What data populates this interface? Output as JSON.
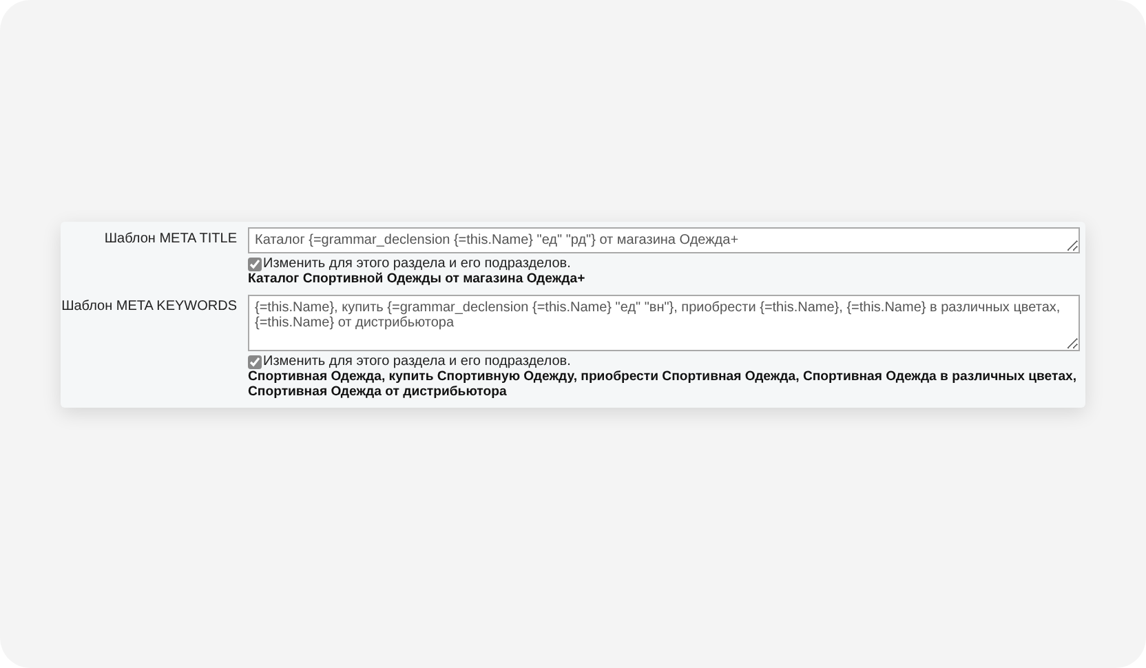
{
  "fields": [
    {
      "label": "Шаблон META TITLE",
      "value": "Каталог {=grammar_declension {=this.Name} \"ед\" \"рд\"} от магазина Одежда+",
      "kind": "line",
      "checkbox": {
        "label": "Изменить для этого раздела и его подразделов.",
        "checked": true
      },
      "preview": "Каталог Спортивной Одежды от магазина Одежда+"
    },
    {
      "label": "Шаблон META KEYWORDS",
      "value": "{=this.Name}, купить {=grammar_declension {=this.Name} \"ед\" \"вн\"}, приобрести {=this.Name}, {=this.Name} в различных цветах, {=this.Name} от дистрибьютора",
      "kind": "area",
      "checkbox": {
        "label": "Изменить для этого раздела и его подразделов.",
        "checked": true
      },
      "preview": "Спортивная Одежда, купить Спортивную Одежду, приобрести Спортивная Одежда, Спортивная Одежда в различных цветах, Спортивная Одежда от дистрибьютора"
    }
  ]
}
